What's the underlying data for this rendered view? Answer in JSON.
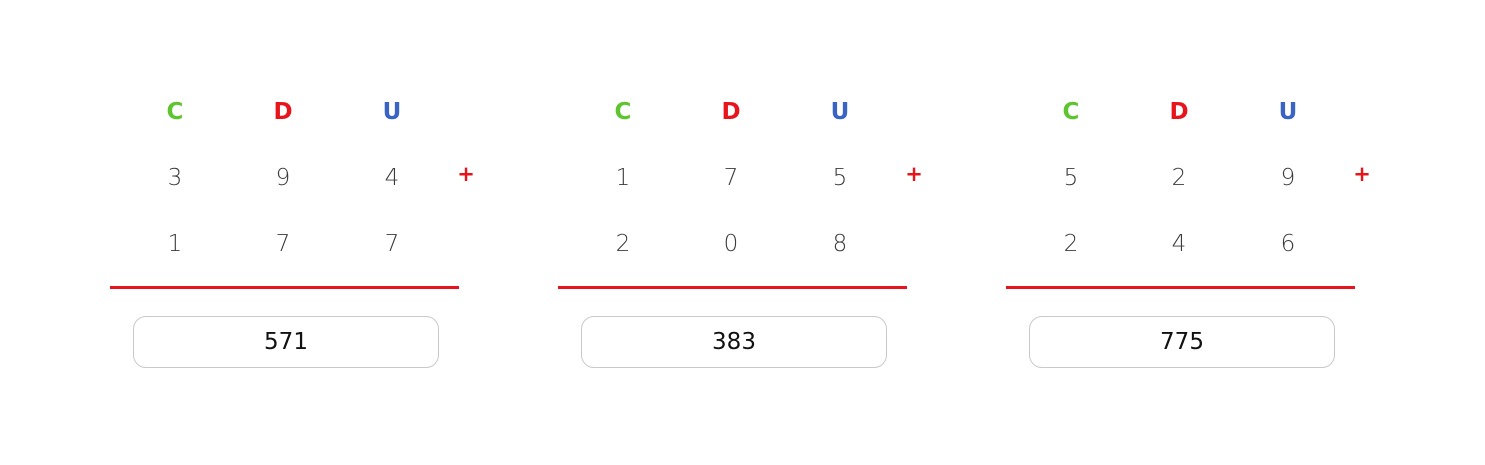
{
  "colors": {
    "hundreds": "#5ec42f",
    "tens": "#e8141c",
    "units": "#3a64c4",
    "accent": "#e8141c",
    "answer_border": "#c9c9c9"
  },
  "headers": {
    "hundreds": "C",
    "tens": "D",
    "units": "U"
  },
  "problems": [
    {
      "row1": [
        "3",
        "9",
        "4"
      ],
      "row2": [
        "1",
        "7",
        "7"
      ],
      "operator": "+",
      "answer": "571"
    },
    {
      "row1": [
        "1",
        "7",
        "5"
      ],
      "row2": [
        "2",
        "0",
        "8"
      ],
      "operator": "+",
      "answer": "383"
    },
    {
      "row1": [
        "5",
        "2",
        "9"
      ],
      "row2": [
        "2",
        "4",
        "6"
      ],
      "operator": "+",
      "answer": "775"
    }
  ]
}
